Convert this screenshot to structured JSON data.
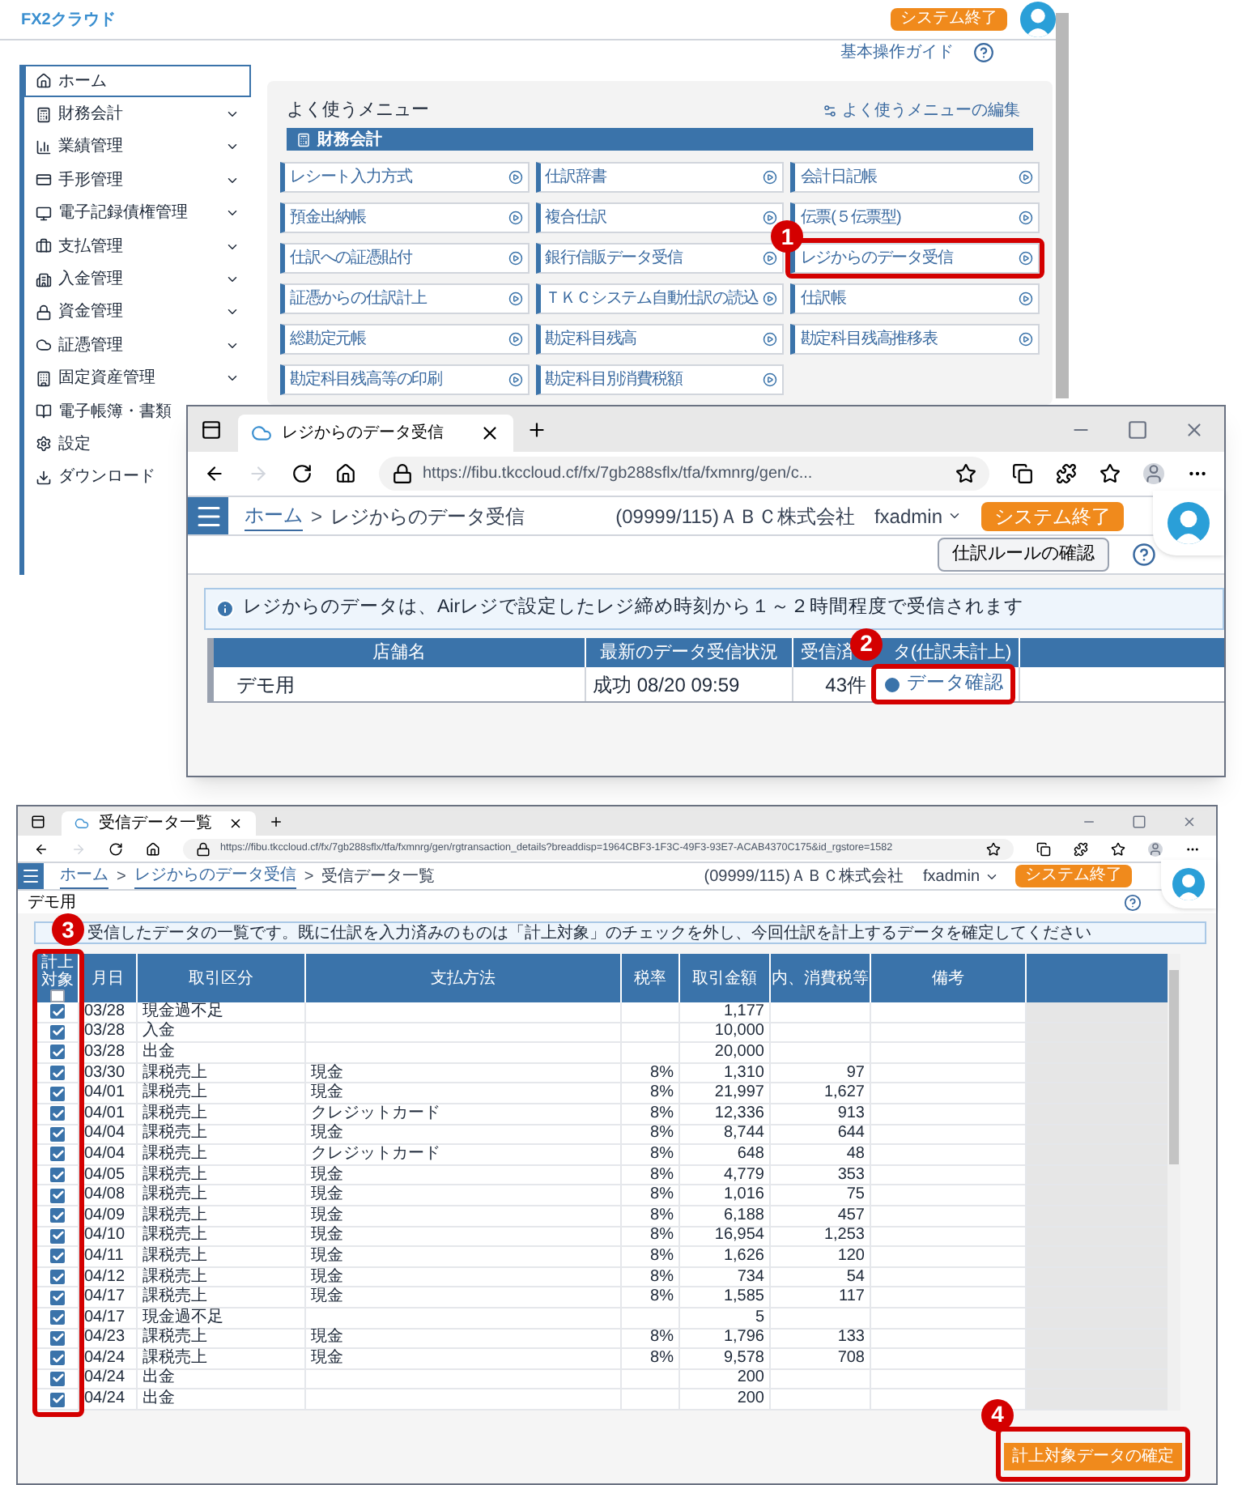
{
  "home_screen": {
    "logo": "FX2クラウド",
    "exit_button": "システム終了",
    "guide_link": "基本操作ガイド",
    "sidebar": [
      {
        "label": "ホーム",
        "selected": true,
        "submenu": false
      },
      {
        "label": "財務会計",
        "selected": false,
        "submenu": true
      },
      {
        "label": "業績管理",
        "selected": false,
        "submenu": true
      },
      {
        "label": "手形管理",
        "selected": false,
        "submenu": true
      },
      {
        "label": "電子記録債権管理",
        "selected": false,
        "submenu": true
      },
      {
        "label": "支払管理",
        "selected": false,
        "submenu": true
      },
      {
        "label": "入金管理",
        "selected": false,
        "submenu": true
      },
      {
        "label": "資金管理",
        "selected": false,
        "submenu": true
      },
      {
        "label": "証憑管理",
        "selected": false,
        "submenu": true
      },
      {
        "label": "固定資産管理",
        "selected": false,
        "submenu": true
      },
      {
        "label": "電子帳簿・書類",
        "selected": false
      },
      {
        "label": "設定",
        "selected": false
      },
      {
        "label": "ダウンロード",
        "selected": false
      }
    ],
    "favorites": {
      "title": "よく使うメニュー",
      "edit_link": "よく使うメニューの編集",
      "section": "財務会計",
      "items": [
        {
          "label": "レシート入力方式"
        },
        {
          "label": "仕訳辞書"
        },
        {
          "label": "会計日記帳"
        },
        {
          "label": "預金出納帳"
        },
        {
          "label": "複合仕訳"
        },
        {
          "label": "伝票(５伝票型)"
        },
        {
          "label": "仕訳への証憑貼付"
        },
        {
          "label": "銀行信販データ受信"
        },
        {
          "label": "レジからのデータ受信",
          "callout": "1"
        },
        {
          "label": "証憑からの仕訳計上"
        },
        {
          "label": "ＴＫＣシステム自動仕訳の読込"
        },
        {
          "label": "仕訳帳"
        },
        {
          "label": "総勘定元帳"
        },
        {
          "label": "勘定科目残高"
        },
        {
          "label": "勘定科目残高推移表"
        },
        {
          "label": "勘定科目残高等の印刷"
        },
        {
          "label": "勘定科目別消費税額"
        }
      ]
    }
  },
  "receive_window": {
    "tab": "レジからのデータ受信",
    "url": "https://fibu.tkccloud.cf/fx/7gb288sflx/tfa/fxmnrg/gen/c...",
    "breadcrumb": [
      "ホーム",
      "レジからのデータ受信"
    ],
    "breadcrumb_separator": ">",
    "company": "(09999/115)ＡＢＣ株式会社",
    "user": "fxadmin",
    "exit_button": "システム終了",
    "rules_button": "仕訳ルールの確認",
    "info": "レジからのデータは、Airレジで設定したレジ締め時刻から１～２時間程度で受信されます",
    "table": {
      "columns": [
        {
          "label": "店舗名"
        },
        {
          "label": "最新のデータ受信状況"
        },
        {
          "label": "受信済",
          "label_after_badge": "タ(仕訳未計上)"
        }
      ],
      "rows": [
        {
          "store": "デモ用",
          "status": "成功 08/20 09:59",
          "count": "43件",
          "action": "データ確認",
          "callout": "2"
        }
      ]
    }
  },
  "list_window": {
    "tab": "受信データ一覧",
    "url": "https://fibu.tkccloud.cf/fx/7gb288sflx/tfa/fxmnrg/gen/rgtransaction_details?breaddisp=1964CBF3-1F3C-49F3-93E7-ACAB4370C175&id_rgstore=1582",
    "breadcrumb": [
      "ホーム",
      "レジからのデータ受信",
      "受信データ一覧"
    ],
    "breadcrumb_separator": ">",
    "company": "(09999/115)ＡＢＣ株式会社",
    "user": "fxadmin",
    "exit_button": "システム終了",
    "store": "デモ用",
    "info": "受信したデータの一覧です。既に仕訳を入力済みのものは「計上対象」のチェックを外し、今回仕訳を計上するデータを確定してください",
    "info_callout": "3",
    "table": {
      "check_column": "計上対象",
      "columns": [
        "月日",
        "取引区分",
        "支払方法",
        "税率",
        "取引金額",
        "内、消費税等",
        "備考"
      ],
      "select_all": false,
      "rows": [
        {
          "checked": true,
          "cells": [
            "03/28",
            "現金過不足",
            "",
            "",
            "1,177",
            ""
          ]
        },
        {
          "checked": true,
          "cells": [
            "03/28",
            "入金",
            "",
            "",
            "10,000",
            ""
          ]
        },
        {
          "checked": true,
          "cells": [
            "03/28",
            "出金",
            "",
            "",
            "20,000",
            ""
          ]
        },
        {
          "checked": true,
          "cells": [
            "03/30",
            "課税売上",
            "現金",
            "8%",
            "1,310",
            "97"
          ]
        },
        {
          "checked": true,
          "cells": [
            "04/01",
            "課税売上",
            "現金",
            "8%",
            "21,997",
            "1,627"
          ]
        },
        {
          "checked": true,
          "cells": [
            "04/01",
            "課税売上",
            "クレジットカード",
            "8%",
            "12,336",
            "913"
          ]
        },
        {
          "checked": true,
          "cells": [
            "04/04",
            "課税売上",
            "現金",
            "8%",
            "8,744",
            "644"
          ]
        },
        {
          "checked": true,
          "cells": [
            "04/04",
            "課税売上",
            "クレジットカード",
            "8%",
            "648",
            "48"
          ]
        },
        {
          "checked": true,
          "cells": [
            "04/05",
            "課税売上",
            "現金",
            "8%",
            "4,779",
            "353"
          ]
        },
        {
          "checked": true,
          "cells": [
            "04/08",
            "課税売上",
            "現金",
            "8%",
            "1,016",
            "75"
          ]
        },
        {
          "checked": true,
          "cells": [
            "04/09",
            "課税売上",
            "現金",
            "8%",
            "6,188",
            "457"
          ]
        },
        {
          "checked": true,
          "cells": [
            "04/10",
            "課税売上",
            "現金",
            "8%",
            "16,954",
            "1,253"
          ]
        },
        {
          "checked": true,
          "cells": [
            "04/11",
            "課税売上",
            "現金",
            "8%",
            "1,626",
            "120"
          ]
        },
        {
          "checked": true,
          "cells": [
            "04/12",
            "課税売上",
            "現金",
            "8%",
            "734",
            "54"
          ]
        },
        {
          "checked": true,
          "cells": [
            "04/17",
            "課税売上",
            "現金",
            "8%",
            "1,585",
            "117"
          ]
        },
        {
          "checked": true,
          "cells": [
            "04/17",
            "現金過不足",
            "",
            "",
            "5",
            ""
          ]
        },
        {
          "checked": true,
          "cells": [
            "04/23",
            "課税売上",
            "現金",
            "8%",
            "1,796",
            "133"
          ]
        },
        {
          "checked": true,
          "cells": [
            "04/24",
            "課税売上",
            "現金",
            "8%",
            "9,578",
            "708"
          ]
        },
        {
          "checked": true,
          "cells": [
            "04/24",
            "出金",
            "",
            "",
            "200",
            ""
          ]
        },
        {
          "checked": true,
          "cells": [
            "04/24",
            "出金",
            "",
            "",
            "200",
            ""
          ]
        }
      ]
    },
    "confirm_button": {
      "label": "計上対象データの確定",
      "callout": "4"
    }
  }
}
